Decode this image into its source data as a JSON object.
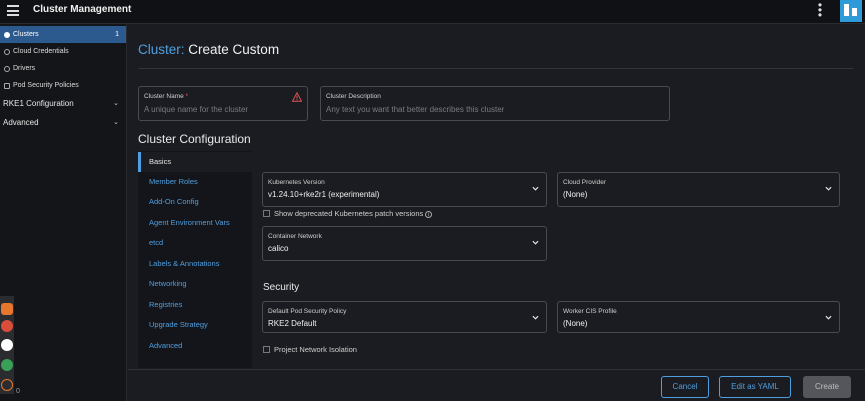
{
  "app": {
    "title": "Cluster Management"
  },
  "sidebar": {
    "items": [
      {
        "label": "Clusters",
        "count": "1",
        "active": true
      },
      {
        "label": "Cloud Credentials"
      },
      {
        "label": "Drivers"
      },
      {
        "label": "Pod Security Policies"
      }
    ],
    "groups": [
      {
        "label": "RKE1 Configuration"
      },
      {
        "label": "Advanced"
      }
    ],
    "version": "0"
  },
  "page": {
    "title_crumb": "Cluster:",
    "title_main": "Create Custom"
  },
  "cluster_name": {
    "label": "Cluster Name",
    "required_marker": "*",
    "placeholder": "A unique name for the cluster"
  },
  "cluster_description": {
    "label": "Cluster Description",
    "placeholder": "Any text you want that better describes this cluster"
  },
  "config": {
    "heading": "Cluster Configuration",
    "tabs": [
      "Basics",
      "Member Roles",
      "Add-On Config",
      "Agent Environment Vars",
      "etcd",
      "Labels & Annotations",
      "Networking",
      "Registries",
      "Upgrade Strategy",
      "Advanced"
    ],
    "kubernetes_version": {
      "label": "Kubernetes Version",
      "value": "v1.24.10+rke2r1 (experimental)"
    },
    "cloud_provider": {
      "label": "Cloud Provider",
      "value": "(None)"
    },
    "deprecated_checkbox": "Show deprecated Kubernetes patch versions",
    "container_network": {
      "label": "Container Network",
      "value": "calico"
    },
    "security_heading": "Security",
    "pod_security_policy": {
      "label": "Default Pod Security Policy",
      "value": "RKE2 Default"
    },
    "worker_cis_profile": {
      "label": "Worker CIS Profile",
      "value": "(None)"
    },
    "network_isolation_checkbox": "Project Network Isolation"
  },
  "footer": {
    "cancel": "Cancel",
    "edit_yaml": "Edit as YAML",
    "create": "Create"
  },
  "colors": {
    "accent": "#4f9fe0",
    "active_nav": "#2d5a8e",
    "warning": "#e05555"
  }
}
